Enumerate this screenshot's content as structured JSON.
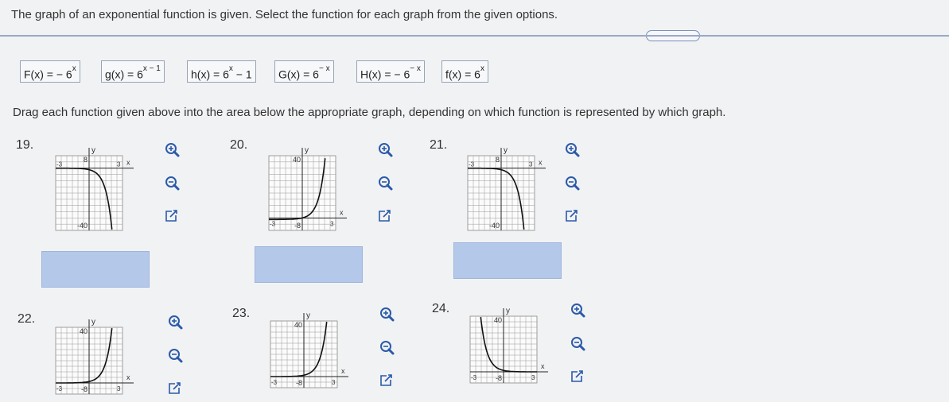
{
  "instructions": "The graph of an exponential function is given. Select the function for each graph from the given options.",
  "more_label": ".....",
  "options": [
    {
      "id": "F",
      "base": "F(x) = − 6",
      "exp": "x"
    },
    {
      "id": "g",
      "base": "g(x) = 6",
      "exp": "x − 1"
    },
    {
      "id": "h",
      "base": "h(x) = 6",
      "exp": "x",
      "tail": " − 1"
    },
    {
      "id": "G",
      "base": "G(x) = 6",
      "exp": "− x"
    },
    {
      "id": "H",
      "base": "H(x) = − 6",
      "exp": "− x"
    },
    {
      "id": "f",
      "base": "f(x) = 6",
      "exp": "x"
    }
  ],
  "drag_instructions": "Drag each function given above into the area below the appropriate graph, depending on which function is represented by which graph.",
  "graphs": [
    {
      "number": "19.",
      "y_label": "y",
      "x_label": "x",
      "y_tick": "8",
      "neg_y_tick": "-40",
      "x_min": "-3",
      "x_max": "3",
      "curve": "neg_growth"
    },
    {
      "number": "20.",
      "y_label": "y",
      "x_label": "x",
      "y_tick": "40",
      "neg_y_tick": "-8",
      "x_min": "-3",
      "x_max": "3",
      "curve": "shifted_growth"
    },
    {
      "number": "21.",
      "y_label": "y",
      "x_label": "x",
      "y_tick": "8",
      "neg_y_tick": "-40",
      "x_min": "-3",
      "x_max": "3",
      "curve": "neg_growth_right"
    },
    {
      "number": "22.",
      "y_label": "y",
      "x_label": "x",
      "y_tick": "40",
      "neg_y_tick": "-8",
      "x_min": "-3",
      "x_max": "3",
      "curve": "growth"
    },
    {
      "number": "23.",
      "y_label": "y",
      "x_label": "x",
      "y_tick": "40",
      "neg_y_tick": "-8",
      "x_min": "-3",
      "x_max": "3",
      "curve": "growth"
    },
    {
      "number": "24.",
      "y_label": "y",
      "x_label": "x",
      "y_tick": "40",
      "neg_y_tick": "-8",
      "x_min": "-3",
      "x_max": "3",
      "curve": "decay"
    }
  ],
  "colors": {
    "drop_zone": "#b4c8ea",
    "tool_icon": "#2b5aa8",
    "curve": "#111111"
  }
}
